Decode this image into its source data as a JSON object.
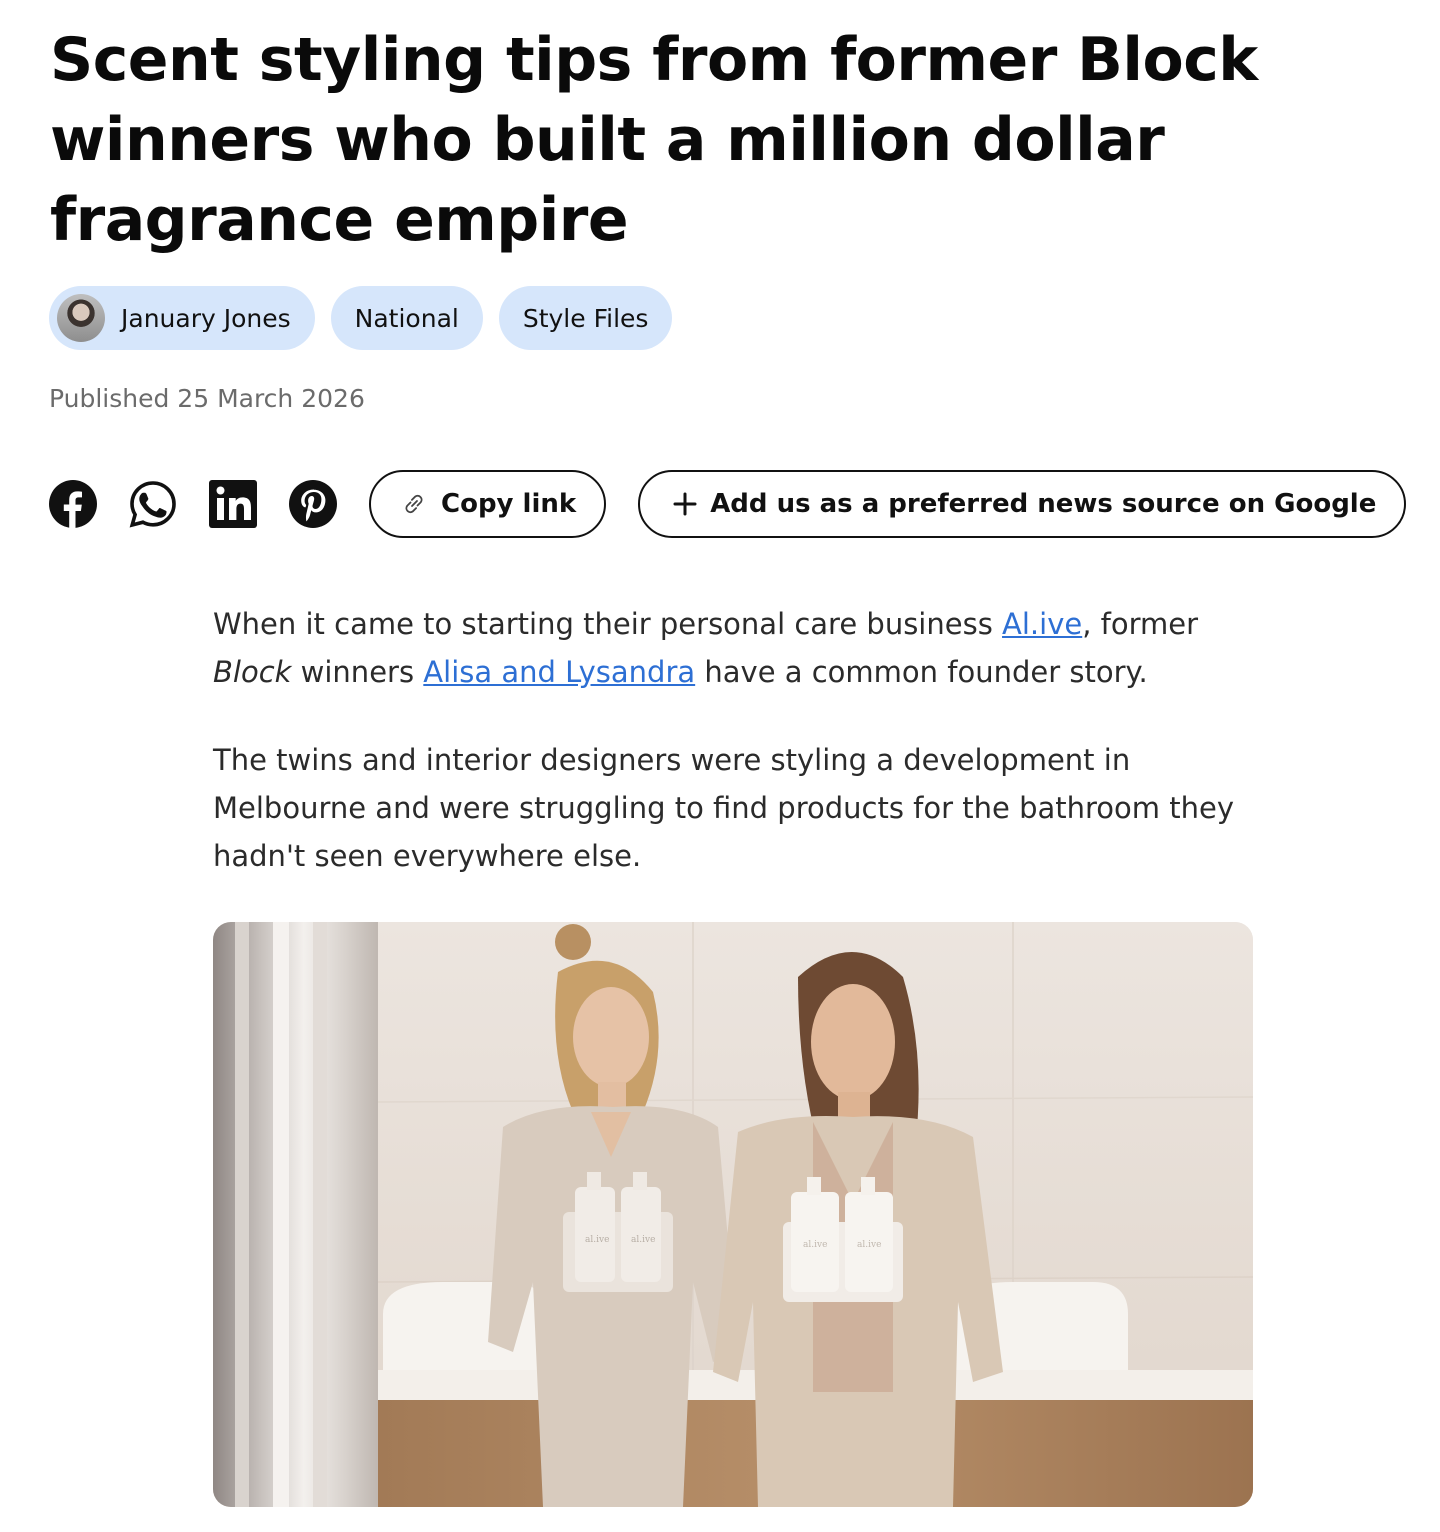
{
  "article": {
    "title": "Scent styling tips from former Block winners who built a million dollar fragrance empire",
    "tags": {
      "author": "January Jones",
      "region": "National",
      "category": "Style Files"
    },
    "published": "Published 25 March 2026",
    "share": {
      "copy_link": "Copy link",
      "google_source": "Add us as a preferred news source on Google"
    },
    "body": {
      "p1": {
        "t1": "When it came to starting their personal care business ",
        "link1": "Al.ive",
        "t2": ", former ",
        "em": "Block",
        "t3": " winners ",
        "link2": "Alisa and Lysandra",
        "t4": " have a common founder story."
      },
      "p2": "The twins and interior designers were styling a development in Melbourne and were struggling to find products for the bathroom they hadn't seen everywhere else."
    },
    "hero": {
      "bottle_label": "al.ive"
    }
  },
  "colors": {
    "tag_bg": "#d6e6fb",
    "link": "#2d6fd4",
    "meta_text": "#6b6b6b"
  },
  "icons": [
    "facebook-icon",
    "whatsapp-icon",
    "linkedin-icon",
    "pinterest-icon",
    "link-icon",
    "plus-icon"
  ]
}
